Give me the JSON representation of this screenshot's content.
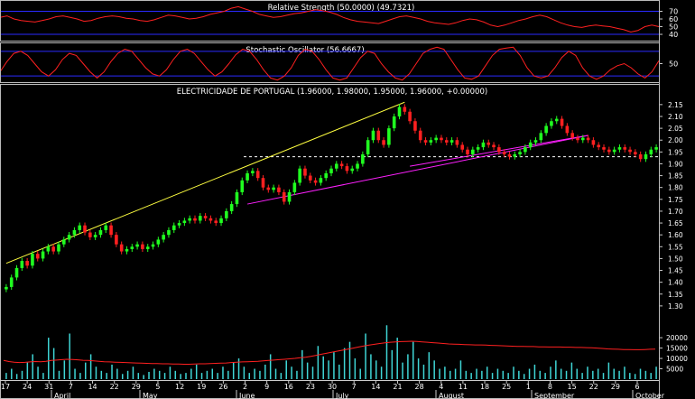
{
  "chart_data": [
    {
      "type": "line",
      "panel": "rsi",
      "title": "Relative Strength (50.0000) (49.7321)",
      "y_ticks": [
        70,
        60,
        50,
        40
      ],
      "ylim": [
        33,
        80
      ],
      "reference_lines": [
        70,
        40
      ],
      "series": [
        {
          "values": [
            62,
            64,
            60,
            58,
            57,
            56,
            58,
            60,
            63,
            64,
            62,
            60,
            57,
            58,
            61,
            63,
            64,
            63,
            61,
            60,
            58,
            57,
            59,
            62,
            65,
            64,
            62,
            60,
            61,
            63,
            66,
            68,
            70,
            74,
            76,
            73,
            70,
            66,
            64,
            62,
            63,
            65,
            67,
            68,
            70,
            72,
            71,
            69,
            66,
            62,
            59,
            57,
            56,
            55,
            54,
            57,
            60,
            63,
            64,
            62,
            60,
            57,
            55,
            54,
            53,
            55,
            58,
            60,
            59,
            56,
            52,
            50,
            52,
            55,
            58,
            60,
            63,
            65,
            63,
            59,
            55,
            52,
            50,
            49,
            51,
            52,
            51,
            50,
            48,
            46,
            43,
            45,
            50,
            52,
            50
          ]
        }
      ],
      "colors": {
        "line": "#ff2020",
        "reference": "#2a2aff"
      }
    },
    {
      "type": "line",
      "panel": "stochastic",
      "title": "Stochastic Oscillator (56.6667)",
      "y_ticks": [
        50
      ],
      "ylim": [
        5,
        95
      ],
      "reference_lines": [
        80,
        20
      ],
      "series": [
        {
          "values": [
            30,
            55,
            75,
            80,
            70,
            50,
            30,
            20,
            35,
            60,
            75,
            70,
            50,
            30,
            15,
            30,
            55,
            75,
            85,
            80,
            60,
            40,
            25,
            20,
            35,
            60,
            80,
            85,
            75,
            55,
            35,
            20,
            30,
            50,
            72,
            85,
            80,
            60,
            35,
            15,
            10,
            20,
            40,
            70,
            85,
            80,
            60,
            35,
            15,
            10,
            15,
            40,
            65,
            80,
            75,
            50,
            30,
            15,
            10,
            25,
            50,
            75,
            85,
            90,
            85,
            60,
            35,
            15,
            12,
            20,
            45,
            70,
            85,
            88,
            90,
            70,
            40,
            20,
            15,
            20,
            40,
            65,
            80,
            70,
            40,
            20,
            12,
            20,
            35,
            45,
            50,
            40,
            25,
            15,
            30,
            57
          ]
        }
      ],
      "colors": {
        "line": "#ff2020",
        "reference": "#2a2aff"
      }
    },
    {
      "type": "candlestick",
      "panel": "price",
      "title": "ELECTRICIDADE DE PORTUGAL (1.96000, 1.98000, 1.95000, 1.96000, +0.00000)",
      "y_ticks": [
        2.15,
        2.1,
        2.05,
        2.0,
        1.95,
        1.9,
        1.85,
        1.8,
        1.75,
        1.7,
        1.65,
        1.6,
        1.55,
        1.5,
        1.45,
        1.4,
        1.35,
        1.3
      ],
      "ylim": [
        1.25,
        2.18
      ],
      "x_tick_labels": [
        "17",
        "24",
        "31",
        "7",
        "14",
        "22",
        "29",
        "5",
        "12",
        "19",
        "26",
        "2",
        "9",
        "16",
        "23",
        "30",
        "7",
        "14",
        "21",
        "28",
        "4",
        "11",
        "18",
        "25",
        "1",
        "8",
        "15",
        "22",
        "29",
        "6"
      ],
      "month_labels": [
        "April",
        "May",
        "June",
        "July",
        "August",
        "September",
        "October"
      ],
      "series": [
        {
          "name": "close",
          "values": [
            1.38,
            1.42,
            1.46,
            1.49,
            1.47,
            1.52,
            1.5,
            1.53,
            1.55,
            1.53,
            1.56,
            1.58,
            1.6,
            1.62,
            1.64,
            1.61,
            1.59,
            1.6,
            1.62,
            1.64,
            1.6,
            1.56,
            1.53,
            1.54,
            1.55,
            1.56,
            1.54,
            1.55,
            1.56,
            1.58,
            1.6,
            1.62,
            1.64,
            1.65,
            1.66,
            1.67,
            1.66,
            1.68,
            1.67,
            1.66,
            1.65,
            1.67,
            1.7,
            1.73,
            1.78,
            1.83,
            1.86,
            1.87,
            1.84,
            1.8,
            1.79,
            1.8,
            1.78,
            1.74,
            1.78,
            1.82,
            1.88,
            1.85,
            1.83,
            1.82,
            1.84,
            1.86,
            1.88,
            1.9,
            1.89,
            1.87,
            1.88,
            1.9,
            1.94,
            2.0,
            2.04,
            2.0,
            1.98,
            2.05,
            2.1,
            2.14,
            2.12,
            2.08,
            2.04,
            2.0,
            1.99,
            2.0,
            2.01,
            2.0,
            1.99,
            2.0,
            1.98,
            1.96,
            1.94,
            1.96,
            1.97,
            1.99,
            1.98,
            1.97,
            1.95,
            1.94,
            1.93,
            1.94,
            1.95,
            1.97,
            1.99,
            2.0,
            2.03,
            2.06,
            2.08,
            2.09,
            2.06,
            2.03,
            2.01,
            2.0,
            2.01,
            2.0,
            1.98,
            1.97,
            1.96,
            1.95,
            1.96,
            1.97,
            1.96,
            1.95,
            1.94,
            1.92,
            1.94,
            1.96,
            1.97
          ]
        }
      ],
      "horizontal_line": 1.93,
      "annotation_lines": [
        {
          "color": "#ffff40",
          "from": {
            "i": 0,
            "price": 1.48
          },
          "to": {
            "i": 76,
            "price": 2.16
          }
        },
        {
          "color": "#ff20ff",
          "from": {
            "i": 46,
            "price": 1.73
          },
          "to": {
            "i": 111,
            "price": 2.02
          }
        },
        {
          "color": "#ff20ff",
          "from": {
            "i": 77,
            "price": 1.89
          },
          "to": {
            "i": 111,
            "price": 2.02
          }
        }
      ],
      "colors": {
        "up": "#20ff20",
        "down": "#ff2020",
        "grid": "#cccccc"
      }
    },
    {
      "type": "bar",
      "panel": "volume",
      "y_ticks": [
        20000,
        15000,
        10000,
        5000
      ],
      "ylim": [
        0,
        27000
      ],
      "series": [
        {
          "name": "volume",
          "values": [
            3000,
            5000,
            2500,
            4000,
            8000,
            12000,
            6000,
            3000,
            20000,
            15000,
            4000,
            9000,
            22000,
            5000,
            3000,
            8000,
            12000,
            6000,
            4000,
            3000,
            7000,
            5000,
            2500,
            4000,
            6000,
            3000,
            2000,
            3500,
            5000,
            4000,
            3000,
            6000,
            4000,
            2500,
            3000,
            5000,
            7000,
            3000,
            4000,
            5000,
            3000,
            6000,
            4000,
            8000,
            10000,
            6000,
            3000,
            5000,
            4000,
            7000,
            12000,
            5000,
            3000,
            9000,
            6000,
            4000,
            14000,
            8000,
            6000,
            16000,
            11000,
            9000,
            13000,
            7000,
            15000,
            18000,
            10000,
            5000,
            22000,
            12000,
            9000,
            6000,
            26000,
            14000,
            20000,
            8000,
            12000,
            18000,
            10000,
            7000,
            13000,
            9000,
            5000,
            6000,
            4000,
            5000,
            9000,
            4000,
            3000,
            5000,
            4000,
            6000,
            3000,
            5000,
            4000,
            3000,
            6000,
            4000,
            2500,
            5000,
            7000,
            4000,
            3000,
            6000,
            9000,
            5000,
            4000,
            8000,
            5000,
            3000,
            6000,
            4000,
            5000,
            3000,
            8000,
            5000,
            4000,
            6000,
            3000,
            2500,
            5000,
            4000,
            3000,
            6000
          ]
        }
      ],
      "moving_average": [
        9000,
        8500,
        8200,
        8000,
        8100,
        8300,
        8500,
        8400,
        8600,
        9000,
        9200,
        9400,
        9600,
        9500,
        9300,
        9100,
        9000,
        8800,
        8600,
        8400,
        8300,
        8200,
        8100,
        8000,
        7900,
        7800,
        7700,
        7600,
        7500,
        7500,
        7400,
        7400,
        7300,
        7300,
        7200,
        7200,
        7300,
        7400,
        7400,
        7500,
        7600,
        7700,
        7800,
        8000,
        8200,
        8300,
        8400,
        8500,
        8600,
        8800,
        9000,
        9200,
        9400,
        9600,
        9800,
        10000,
        10300,
        10600,
        11000,
        11500,
        12000,
        12500,
        13000,
        13500,
        14000,
        14500,
        15000,
        15500,
        16000,
        16400,
        16800,
        17200,
        17500,
        17800,
        18000,
        18100,
        18200,
        18300,
        18200,
        18000,
        17800,
        17600,
        17400,
        17200,
        17000,
        16900,
        16800,
        16700,
        16600,
        16500,
        16500,
        16400,
        16300,
        16200,
        16100,
        16000,
        15900,
        15800,
        15800,
        15700,
        15700,
        15600,
        15600,
        15500,
        15500,
        15500,
        15400,
        15400,
        15300,
        15300,
        15200,
        15100,
        15000,
        14800,
        14600,
        14500,
        14400,
        14300,
        14300,
        14200,
        14200,
        14300,
        14400,
        14500
      ],
      "colors": {
        "bar": "#3fd6d6",
        "ma": "#ff2020"
      }
    }
  ]
}
